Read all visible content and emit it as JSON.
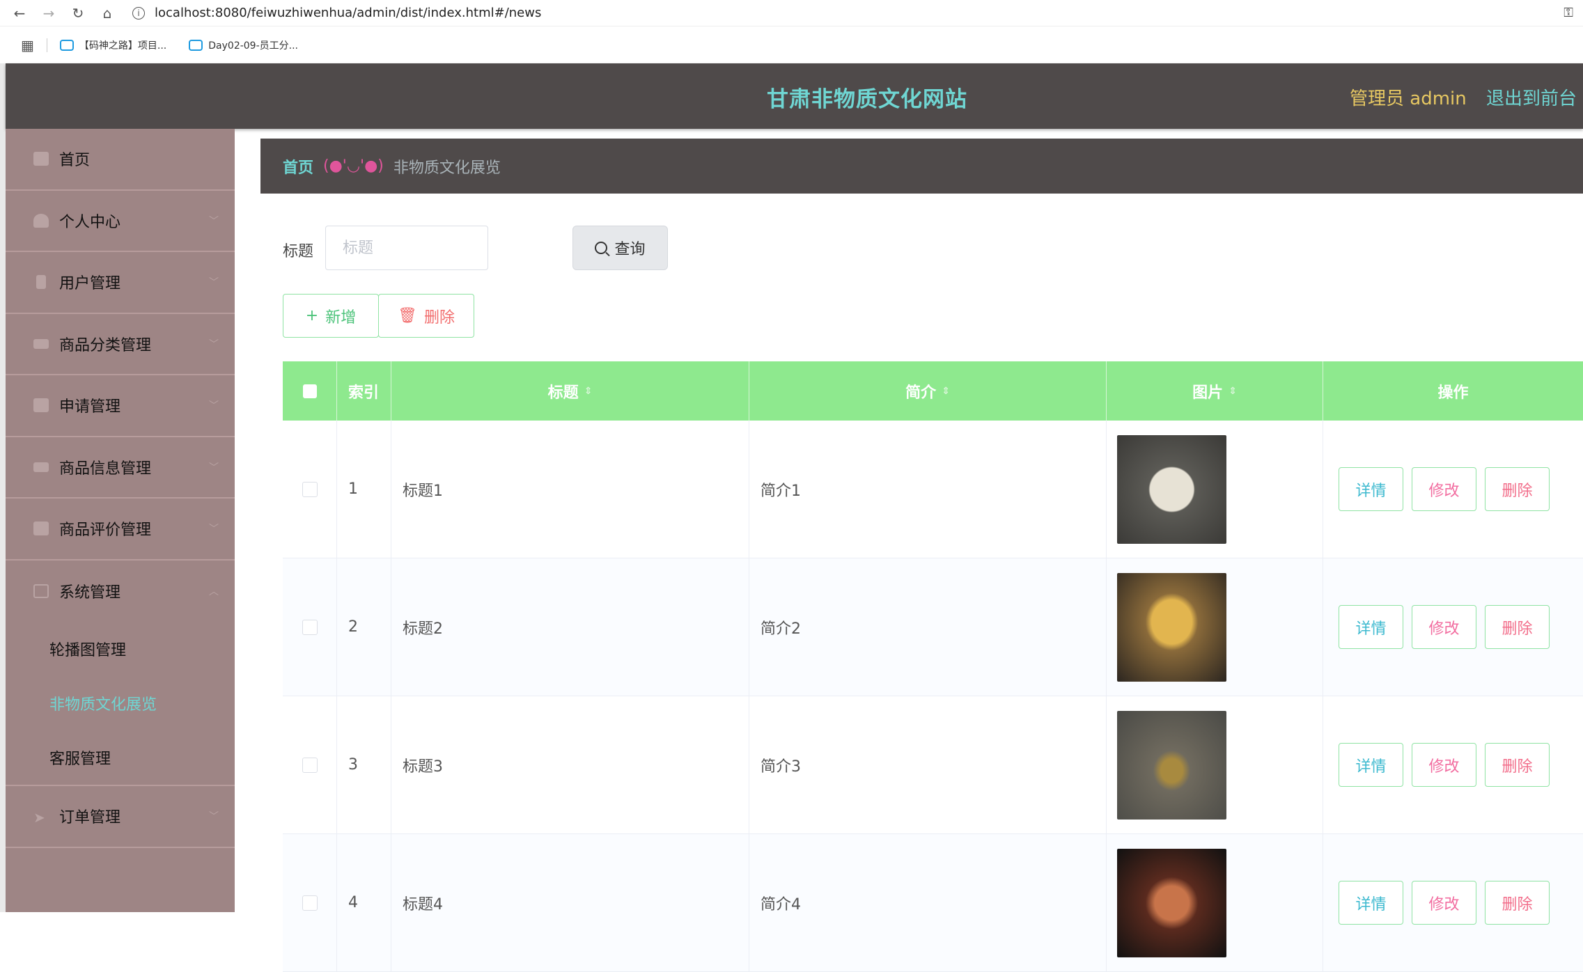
{
  "browser": {
    "url": "localhost:8080/feiwuzhiwenhua/admin/dist/index.html#/news",
    "bookmarks": [
      "【码神之路】项目...",
      "Day02-09-员工分..."
    ]
  },
  "header": {
    "title": "甘肃非物质文化网站",
    "admin_label": "管理员 admin",
    "logout_label": "退出到前台"
  },
  "sidebar": {
    "items": [
      {
        "label": "首页",
        "icon": "home-icon"
      },
      {
        "label": "个人中心",
        "icon": "user-icon"
      },
      {
        "label": "用户管理",
        "icon": "phone-icon"
      },
      {
        "label": "商品分类管理",
        "icon": "ticket-icon"
      },
      {
        "label": "申请管理",
        "icon": "briefcase-icon"
      },
      {
        "label": "商品信息管理",
        "icon": "list-icon"
      },
      {
        "label": "商品评价管理",
        "icon": "box-icon"
      },
      {
        "label": "系统管理",
        "icon": "crop-icon"
      },
      {
        "label": "订单管理",
        "icon": "send-icon"
      }
    ],
    "sub_items": [
      "轮播图管理",
      "非物质文化展览",
      "客服管理"
    ]
  },
  "breadcrumb": {
    "home": "首页",
    "separator": "(●'◡'●)",
    "current": "非物质文化展览"
  },
  "search": {
    "label": "标题",
    "placeholder": "标题",
    "button": "查询"
  },
  "actions": {
    "add": "新增",
    "delete": "删除"
  },
  "table": {
    "columns": [
      "索引",
      "标题",
      "简介",
      "图片",
      "操作"
    ],
    "rows": [
      {
        "index": "1",
        "title": "标题1",
        "intro": "简介1"
      },
      {
        "index": "2",
        "title": "标题2",
        "intro": "简介2"
      },
      {
        "index": "3",
        "title": "标题3",
        "intro": "简介3"
      },
      {
        "index": "4",
        "title": "标题4",
        "intro": "简介4"
      }
    ],
    "row_actions": {
      "detail": "详情",
      "edit": "修改",
      "delete": "删除"
    }
  },
  "colors": {
    "header_bg": "#4f4a4a",
    "sidebar_bg": "#9e8585",
    "accent_cyan": "#6fd6d3",
    "accent_yellow": "#e7c862",
    "table_header": "#8ee98e"
  }
}
